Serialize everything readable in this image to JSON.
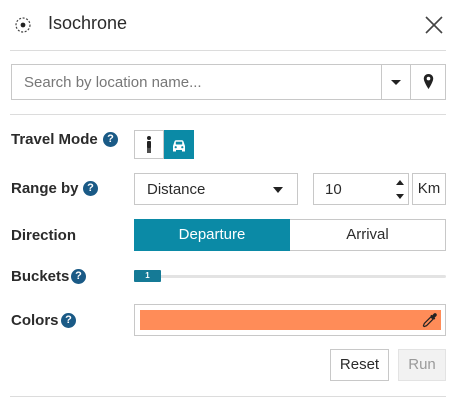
{
  "header": {
    "title": "Isochrone",
    "icon": "radio-target-icon",
    "close_icon": "close-icon"
  },
  "search": {
    "placeholder": "Search by location name...",
    "value": "",
    "dropdown_icon": "caret-down-icon",
    "location_icon": "map-pin-icon"
  },
  "travel_mode": {
    "label": "Travel Mode",
    "help": "?",
    "options": [
      {
        "icon": "walking-person-icon",
        "selected": false
      },
      {
        "icon": "car-icon",
        "selected": true
      }
    ]
  },
  "range_by": {
    "label": "Range by",
    "help": "?",
    "selected": "Distance",
    "value": "10",
    "unit": "Km"
  },
  "direction": {
    "label": "Direction",
    "options": [
      "Departure",
      "Arrival"
    ],
    "selected": "Departure"
  },
  "buckets": {
    "label": "Buckets",
    "help": "?",
    "value": "1",
    "min": 1,
    "max": 10
  },
  "colors": {
    "label": "Colors",
    "help": "?",
    "swatch": "#ff8c58",
    "picker_icon": "eyedropper-icon"
  },
  "actions": {
    "reset": "Reset",
    "run": "Run"
  },
  "theme": {
    "accent": "#0b8aa6",
    "help_badge": "#1a5a86"
  }
}
